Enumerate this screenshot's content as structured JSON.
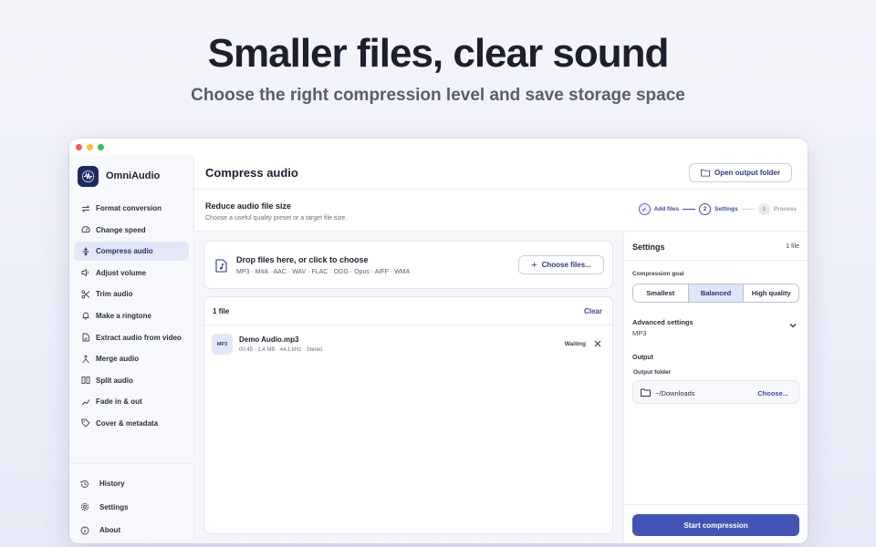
{
  "hero": {
    "title": "Smaller files, clear sound",
    "subtitle": "Choose the right compression level and save storage space"
  },
  "app": {
    "name": "OmniAudio",
    "accent_color": "#4454b5"
  },
  "sidebar": {
    "items": [
      {
        "label": "Format conversion",
        "icon": "swap-arrows-icon",
        "active": false
      },
      {
        "label": "Change speed",
        "icon": "speedometer-icon",
        "active": false
      },
      {
        "label": "Compress audio",
        "icon": "compress-icon",
        "active": true
      },
      {
        "label": "Adjust volume",
        "icon": "volume-icon",
        "active": false
      },
      {
        "label": "Trim audio",
        "icon": "scissors-icon",
        "active": false
      },
      {
        "label": "Make a ringtone",
        "icon": "bell-icon",
        "active": false
      },
      {
        "label": "Extract audio from video",
        "icon": "file-icon",
        "active": false
      },
      {
        "label": "Merge audio",
        "icon": "merge-icon",
        "active": false
      },
      {
        "label": "Split audio",
        "icon": "split-icon",
        "active": false
      },
      {
        "label": "Fade in & out",
        "icon": "fade-icon",
        "active": false
      },
      {
        "label": "Cover & metadata",
        "icon": "tag-icon",
        "active": false
      }
    ],
    "bottom": [
      {
        "label": "History",
        "icon": "history-icon"
      },
      {
        "label": "Settings",
        "icon": "gear-icon"
      },
      {
        "label": "About",
        "icon": "info-icon"
      }
    ]
  },
  "header": {
    "title": "Compress audio",
    "open_folder_label": "Open output folder"
  },
  "subheader": {
    "title": "Reduce audio file size",
    "description": "Choose a useful quality preset or a target file size.",
    "steps": [
      {
        "label": "Add files",
        "state": "done",
        "marker": "✓"
      },
      {
        "label": "Settings",
        "state": "current",
        "marker": "2"
      },
      {
        "label": "Process",
        "state": "pending",
        "marker": "3"
      }
    ]
  },
  "dropzone": {
    "title": "Drop files here, or click to choose",
    "formats": "MP3 · M4A · AAC · WAV · FLAC · OGG · Opus · AIFF · WMA",
    "button_label": "Choose files..."
  },
  "filelist": {
    "count_label": "1 file",
    "clear_label": "Clear",
    "files": [
      {
        "badge": "MP3",
        "name": "Demo Audio.mp3",
        "meta": "00:45 · 1.4 MB · 44.1 kHz · Stereo",
        "status": "Waiting"
      }
    ]
  },
  "settings": {
    "title": "Settings",
    "count": "1 file",
    "goal_label": "Compression goal",
    "goal_options": [
      "Smallest",
      "Balanced",
      "High quality"
    ],
    "goal_selected": "Balanced",
    "advanced_title": "Advanced settings",
    "advanced_value": "MP3",
    "output_title": "Output",
    "folder_label": "Output folder",
    "folder_path": "~/Downloads",
    "choose_label": "Choose...",
    "start_label": "Start compression"
  }
}
